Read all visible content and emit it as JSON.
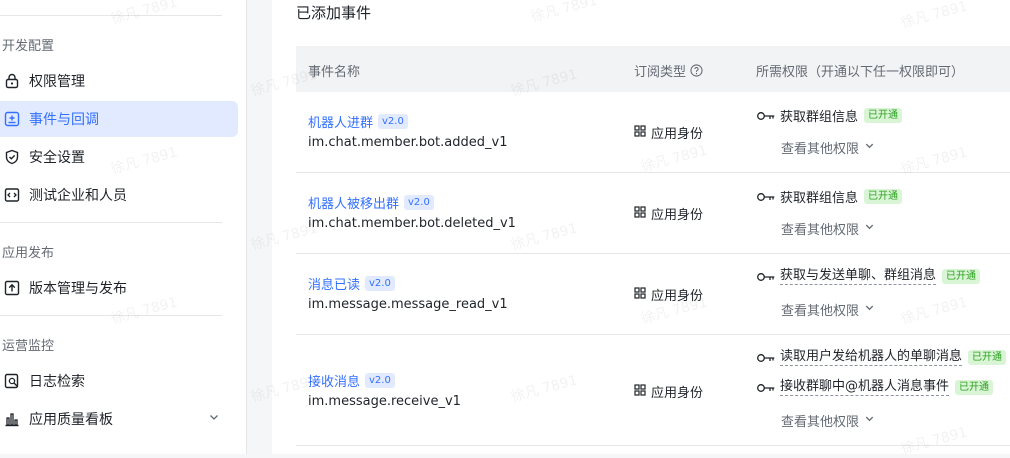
{
  "sidebar": {
    "sections": [
      {
        "title": "开发配置"
      },
      {
        "title": "应用发布"
      },
      {
        "title": "运营监控"
      }
    ],
    "items": [
      {
        "label": "权限管理",
        "icon": "lock-icon"
      },
      {
        "label": "事件与回调",
        "icon": "event-plus-icon",
        "active": true
      },
      {
        "label": "安全设置",
        "icon": "shield-check-icon"
      },
      {
        "label": "测试企业和人员",
        "icon": "code-icon"
      },
      {
        "label": "版本管理与发布",
        "icon": "upload-icon"
      },
      {
        "label": "日志检索",
        "icon": "log-search-icon"
      },
      {
        "label": "应用质量看板",
        "icon": "bar-chart-icon"
      }
    ]
  },
  "main": {
    "heading": "已添加事件",
    "columns": {
      "name": "事件名称",
      "sub_type": "订阅类型",
      "permissions": "所需权限（开通以下任一权限即可）"
    },
    "more_perms_label": "查看其他权限",
    "rows": [
      {
        "name": "机器人进群",
        "version": "v2.0",
        "code": "im.chat.member.bot.added_v1",
        "sub_type": "应用身份",
        "perms": [
          {
            "text": "获取群组信息",
            "status": "已开通"
          }
        ]
      },
      {
        "name": "机器人被移出群",
        "version": "v2.0",
        "code": "im.chat.member.bot.deleted_v1",
        "sub_type": "应用身份",
        "perms": [
          {
            "text": "获取群组信息",
            "status": "已开通"
          }
        ]
      },
      {
        "name": "消息已读",
        "version": "v2.0",
        "code": "im.message.message_read_v1",
        "sub_type": "应用身份",
        "perms": [
          {
            "text": "获取与发送单聊、群组消息",
            "status": "已开通"
          }
        ]
      },
      {
        "name": "接收消息",
        "version": "v2.0",
        "code": "im.message.receive_v1",
        "sub_type": "应用身份",
        "perms": [
          {
            "text": "读取用户发给机器人的单聊消息",
            "status": "已开通"
          },
          {
            "text": "接收群聊中@机器人消息事件",
            "status": "已开通"
          }
        ]
      }
    ]
  },
  "watermark": "徐凡 7891",
  "colors": {
    "accent": "#3370ff",
    "active_bg": "#e1eaff",
    "success": "#2ea121",
    "success_bg": "#d9f5d6"
  }
}
